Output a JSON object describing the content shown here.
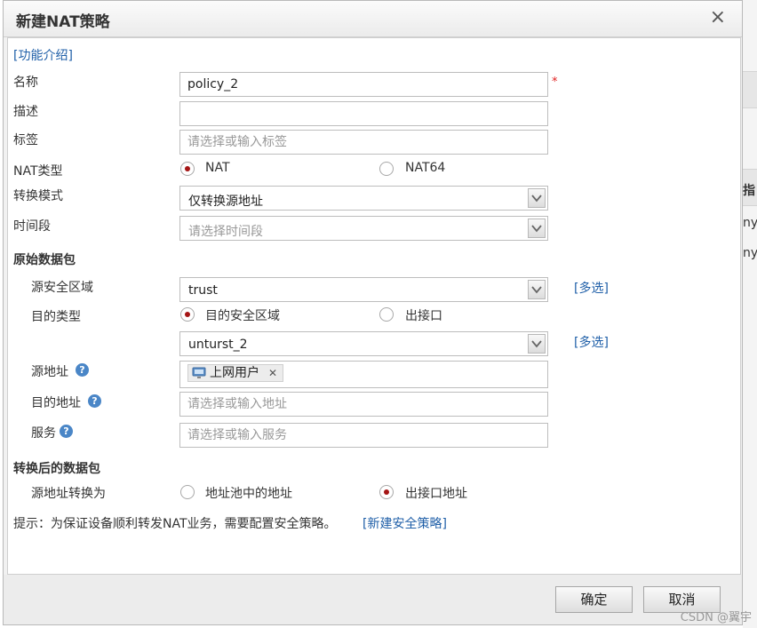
{
  "background": {
    "text_1": "指",
    "text_2": "ny",
    "text_3": "ny"
  },
  "dialog": {
    "title": "新建NAT策略",
    "close": "×",
    "intro_link": "[功能介绍]",
    "fields": {
      "name": {
        "label": "名称",
        "value": "policy_2",
        "required": "*"
      },
      "desc": {
        "label": "描述",
        "value": ""
      },
      "tags": {
        "label": "标签",
        "placeholder": "请选择或输入标签"
      },
      "nat_type": {
        "label": "NAT类型",
        "options": [
          "NAT",
          "NAT64"
        ],
        "selected": "NAT"
      },
      "mode": {
        "label": "转换模式",
        "value": "仅转换源地址"
      },
      "time": {
        "label": "时间段",
        "placeholder": "请选择时间段"
      }
    },
    "orig": {
      "title": "原始数据包",
      "src_zone": {
        "label": "源安全区域",
        "value": "trust",
        "link": "[多选]"
      },
      "dst_type": {
        "label": "目的类型",
        "options": [
          "目的安全区域",
          "出接口"
        ],
        "selected": "目的安全区域"
      },
      "dst_zone": {
        "value": "unturst_2",
        "link": "[多选]"
      },
      "src_addr": {
        "label": "源地址",
        "tag": "上网用户"
      },
      "dst_addr": {
        "label": "目的地址",
        "placeholder": "请选择或输入地址"
      },
      "service": {
        "label": "服务",
        "placeholder": "请选择或输入服务"
      }
    },
    "trans": {
      "title": "转换后的数据包",
      "src_to": {
        "label": "源地址转换为",
        "options": [
          "地址池中的地址",
          "出接口地址"
        ],
        "selected": "出接口地址"
      }
    },
    "tip": {
      "text": "提示：为保证设备顺利转发NAT业务，需要配置安全策略。",
      "link": "[新建安全策略]"
    },
    "help": "?",
    "buttons": {
      "ok": "确定",
      "cancel": "取消"
    }
  },
  "watermark": "CSDN @翼宇",
  "colors": {
    "accent_link": "#1f5fa8",
    "radio_dot": "#a51515",
    "required": "#e02020",
    "help_icon": "#4a86c7"
  }
}
